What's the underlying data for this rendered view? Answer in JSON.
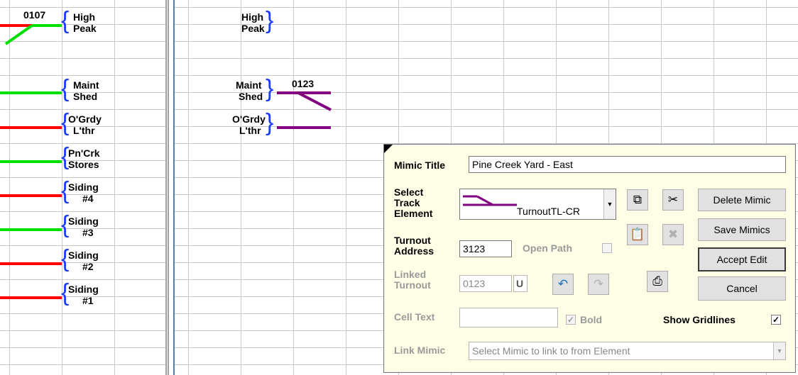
{
  "mimic_left": {
    "cell_0107": "0107",
    "labels": [
      {
        "l1": "High",
        "l2": "Peak"
      },
      {
        "l1": "Maint",
        "l2": "Shed"
      },
      {
        "l1": "O'Grdy",
        "l2": "L'thr"
      },
      {
        "l1": "Pn'Crk",
        "l2": "Stores"
      },
      {
        "l1": "Siding",
        "l2": "#4"
      },
      {
        "l1": "Siding",
        "l2": "#3"
      },
      {
        "l1": "Siding",
        "l2": "#2"
      },
      {
        "l1": "Siding",
        "l2": "#1"
      }
    ]
  },
  "mimic_right": {
    "cell_0123": "0123",
    "labels": [
      {
        "l1": "High",
        "l2": "Peak"
      },
      {
        "l1": "Maint",
        "l2": "Shed"
      },
      {
        "l1": "O'Grdy",
        "l2": "L'thr"
      }
    ]
  },
  "track_colors": {
    "occupied": "#ff0000",
    "clear": "#00e000",
    "selected": "#800080"
  },
  "dialog": {
    "mimic_title_label": "Mimic Title",
    "mimic_title_value": "Pine Creek Yard - East",
    "select_track_label_1": "Select",
    "select_track_label_2": "Track",
    "select_track_label_3": "Element",
    "select_track_value": "TurnoutTL-CR",
    "turnout_address_label_1": "Turnout",
    "turnout_address_label_2": "Address",
    "turnout_address_value": "3123",
    "open_path_label": "Open Path",
    "linked_turnout_label_1": "Linked",
    "linked_turnout_label_2": "Turnout",
    "linked_turnout_value": "0123",
    "linked_turnout_flag": "U",
    "cell_text_label": "Cell Text",
    "cell_text_value": "",
    "bold_label": "Bold",
    "show_gridlines_label": "Show Gridlines",
    "show_gridlines_check": "✓",
    "bold_check": "✓",
    "link_mimic_label": "Link Mimic",
    "link_mimic_placeholder": "Select Mimic to link to from Element",
    "delete_mimic": "Delete Mimic",
    "save_mimics": "Save Mimics",
    "accept_edit": "Accept Edit",
    "cancel": "Cancel",
    "icons": [
      "copy-icon",
      "cut-icon",
      "paste-icon",
      "delete-element-icon",
      "undo-icon",
      "redo-icon",
      "print-icon"
    ]
  }
}
